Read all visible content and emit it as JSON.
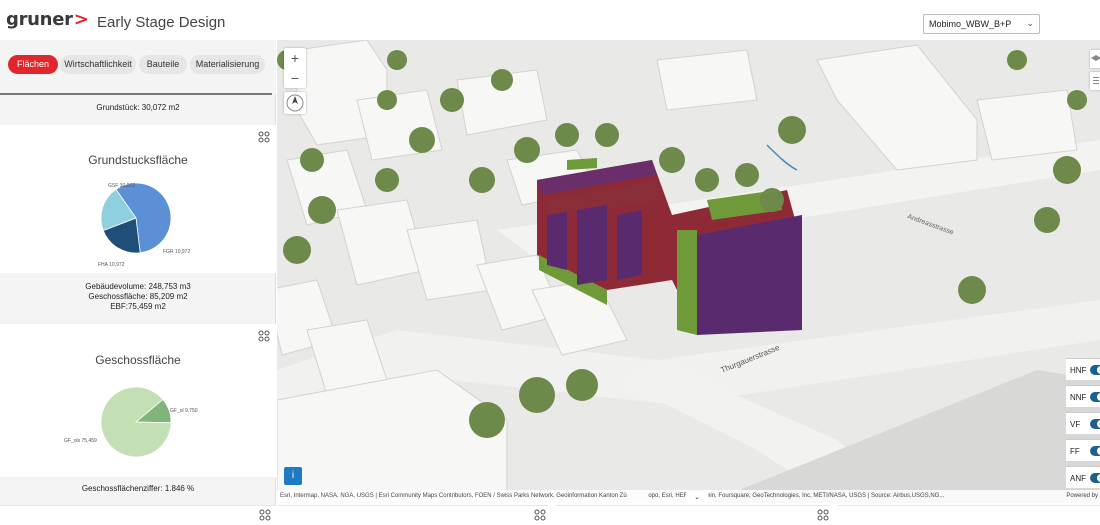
{
  "header": {
    "logo_text": "gruner",
    "logo_mark": ">",
    "title": "Early Stage Design",
    "project_selected": "Mobimo_WBW_B+P"
  },
  "tabs": [
    {
      "label": "Flächen",
      "active": true
    },
    {
      "label": "Wirtschaftlichkeit",
      "active": false
    },
    {
      "label": "Bauteile",
      "active": false
    },
    {
      "label": "Materialisierung",
      "active": false
    }
  ],
  "grundstueck_text": "Grundstück: 30,072 m2",
  "card1": {
    "title": "Grundstucksfläche",
    "metrics": [
      "Gebäudevolume: 248,753 m3",
      "Geschossfläche: 85,209  m2",
      "EBF:75,459  m2"
    ]
  },
  "card2": {
    "title": "Geschossfläche",
    "footer": "Geschossflächenziffer: 1.846  %"
  },
  "chart_data": [
    {
      "type": "pie",
      "title": "Grundstucksfläche",
      "labels": [
        "GSF 30,072",
        "FGR 10,972",
        "FHA 10,972"
      ],
      "values": [
        30072,
        10972,
        10972
      ],
      "colors": [
        "#5b8fd6",
        "#1f4e79",
        "#8fd0e0"
      ]
    },
    {
      "type": "pie",
      "title": "Geschossfläche",
      "labels": [
        "GF_ol 9,750",
        "GF_ols 75,459"
      ],
      "values": [
        9750,
        75459
      ],
      "colors": [
        "#7fb57a",
        "#c3e0b4"
      ]
    }
  ],
  "map": {
    "street1": "Andreasstrasse",
    "street2": "Thurgauerstrasse",
    "attribution": "Esri, Intermap, NASA, NGA, USGS | Esri Community Maps Contributors, FOEN / Swiss Parks Network, Geoinformation Kanton Zü",
    "attribution2": "opo, Esri, HERE, Garmin, Foursquare, GeoTechnologies, Inc, METI/NASA, USGS | Source: Airbus,USGS,NG...",
    "powered_by": "Powered by",
    "zoom_in": "+",
    "zoom_out": "−",
    "info": "i",
    "layer_toggles": [
      {
        "label": "HNF",
        "on": true
      },
      {
        "label": "NNF",
        "on": true
      },
      {
        "label": "VF",
        "on": true
      },
      {
        "label": "FF",
        "on": true
      },
      {
        "label": "ANF",
        "on": true
      }
    ]
  },
  "colors": {
    "accent": "#e3262b",
    "building_red": "#8e2a35",
    "building_purple": "#5a2a6e",
    "building_green": "#6f9a3a",
    "toggle_blue": "#1f5f8b"
  }
}
